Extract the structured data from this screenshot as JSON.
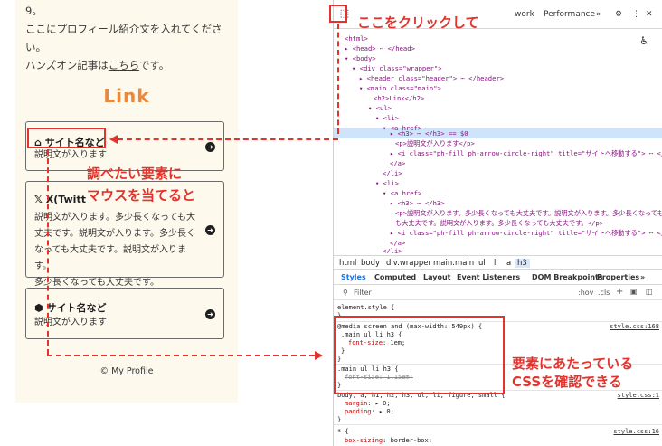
{
  "page": {
    "intro_line1": "9。",
    "intro_line2": "ここにプロフィール紹介文を入れてください。",
    "intro_line3_prefix": "ハンズオン記事は",
    "intro_link": "こちら",
    "intro_line3_suffix": "です。",
    "logo": "Link",
    "cards": [
      {
        "icon": "⌂",
        "title": "サイト名など",
        "desc": [
          "説明文が入ります"
        ]
      },
      {
        "icon": "𝕏",
        "title": "X(Twitt",
        "desc": [
          "説明文が入ります。多少長くなっても大",
          "丈夫です。説明文が入ります。多少長く",
          "なっても大丈夫です。説明文が入ります。",
          "多少長くなっても大丈夫です。"
        ]
      },
      {
        "icon": "⬢",
        "title": "サイト名など",
        "desc": [
          "説明文が入ります"
        ]
      }
    ],
    "footer_prefix": "© ",
    "footer_link": "My Profile"
  },
  "devtools": {
    "tab_network": "work",
    "tab_performance": "Performance",
    "more_tabs": "»",
    "dom_lines": [
      "<html>",
      "▸ <head> ⋯ </head>",
      "▾ <body>",
      "▾ <div class=\"wrapper\">",
      "▸ <header class=\"header\"> ⋯ </header>",
      "▾ <main class=\"main\">",
      "<h2>Link</h2>",
      "▾ <ul>",
      "▾ <li>",
      "▾ <a href>",
      "▸ <h3> ⋯ </h3> == $0",
      "<p>説明文が入ります</p>",
      "▸ <i class=\"ph-fill ph-arrow-circle-right\" title=\"サイトへ移動する\"> ⋯ </i>",
      "</a>",
      "</li>",
      "▾ <li>",
      "▾ <a href>",
      "▸ <h3> ⋯ </h3>",
      "<p>説明文が入ります。多少長くなっても大丈夫です。説明文が入ります。多少長くなっても",
      "も大丈夫です。説明文が入ります。多少長くなっても大丈夫です。</p>",
      "▸ <i class=\"ph-fill ph-arrow-circle-right\" title=\"サイトへ移動する\"> ⋯ </i>",
      "</a>",
      "</li>"
    ],
    "breadcrumbs": [
      "html",
      "body",
      "div.wrapper",
      "main.main",
      "ul",
      "li",
      "a",
      "h3"
    ],
    "subtabs": [
      "Styles",
      "Computed",
      "Layout",
      "Event Listeners",
      "DOM Breakpoints",
      "Properties",
      "»"
    ],
    "filter_placeholder": "Filter",
    "filter_hov": ":hov",
    "filter_cls": ".cls",
    "styles": {
      "element_style": "element.style {",
      "close": "}",
      "media": "@media screen and (max-width: 549px) {",
      "sel1": ".main ul li h3 {",
      "prop1": "font-size",
      "val1": "1em;",
      "src1": "style.css:168",
      "sel2": ".main ul li h3 {",
      "prop2_struck": "font-size: 1.15em;",
      "sel3": "body, a, h1, h2, h3, ul, li, figure, small {",
      "prop3a": "margin",
      "val3a": "▸ 0;",
      "prop3b": "padding",
      "val3b": "▸ 0;",
      "src3": "style.css:1",
      "sel4": "* {",
      "prop4": "box-sizing",
      "val4": "border-box;",
      "src4": "style.css:16"
    }
  },
  "annotations": {
    "click_here": "ここをクリックして",
    "hover_line1": "調べたい要素に",
    "hover_line2": "マウスを当てると",
    "css_line1": "要素にあたっている",
    "css_line2": "CSSを確認できる",
    "accent": "#e4332d"
  }
}
